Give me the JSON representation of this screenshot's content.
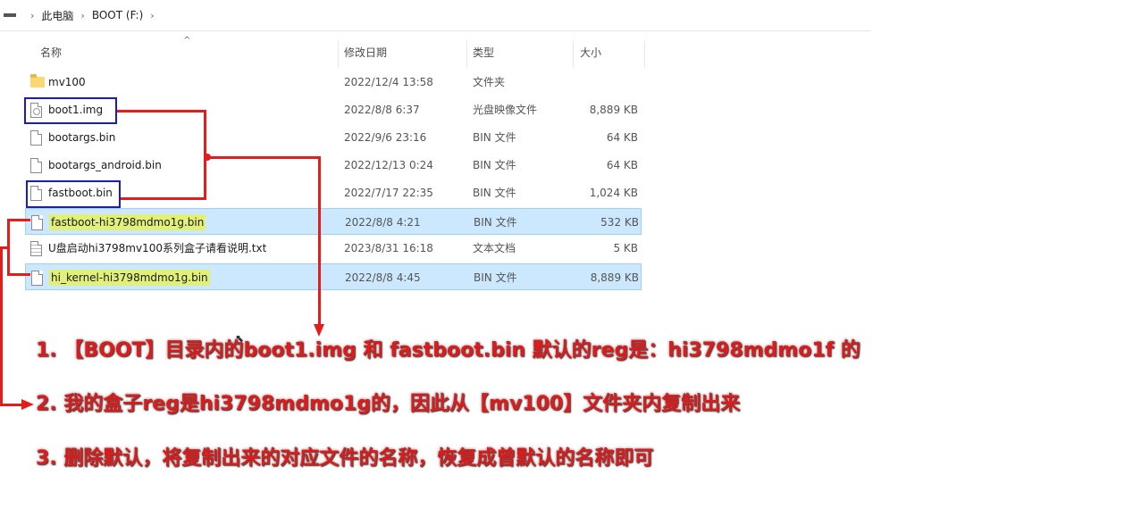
{
  "address_bar": {
    "crumbs": [
      "此电脑",
      "BOOT (F:)"
    ]
  },
  "columns": {
    "name": "名称",
    "date": "修改日期",
    "type": "类型",
    "size": "大小"
  },
  "files": [
    {
      "name": "mv100",
      "date": "2022/12/4 13:58",
      "type": "文件夹",
      "size": "",
      "icon": "folder-icon"
    },
    {
      "name": "boot1.img",
      "date": "2022/8/8 6:37",
      "type": "光盘映像文件",
      "size": "8,889 KB",
      "icon": "disc-image-file-icon"
    },
    {
      "name": "bootargs.bin",
      "date": "2022/9/6 23:16",
      "type": "BIN 文件",
      "size": "64 KB",
      "icon": "file-icon"
    },
    {
      "name": "bootargs_android.bin",
      "date": "2022/12/13 0:24",
      "type": "BIN 文件",
      "size": "64 KB",
      "icon": "file-icon"
    },
    {
      "name": "fastboot.bin",
      "date": "2022/7/17 22:35",
      "type": "BIN 文件",
      "size": "1,024 KB",
      "icon": "file-icon"
    },
    {
      "name": "fastboot-hi3798mdmo1g.bin",
      "date": "2022/8/8 4:21",
      "type": "BIN 文件",
      "size": "532 KB",
      "icon": "file-icon",
      "selected": true
    },
    {
      "name": "U盘启动hi3798mv100系列盒子请看说明.txt",
      "date": "2023/8/31 16:18",
      "type": "文本文档",
      "size": "5 KB",
      "icon": "text-file-icon"
    },
    {
      "name": "hi_kernel-hi3798mdmo1g.bin",
      "date": "2022/8/8 4:45",
      "type": "BIN 文件",
      "size": "8,889 KB",
      "icon": "file-icon",
      "selected": true
    }
  ],
  "notes": [
    "1. 【BOOT】目录内的boot1.img 和 fastboot.bin 默认的reg是：hi3798mdmo1f 的",
    "2. 我的盒子reg是hi3798mdmo1g的，因此从【mv100】文件夹内复制出来",
    "3. 删除默认，将复制出来的对应文件的名称，恢复成曾默认的名称即可"
  ],
  "colors": {
    "annotation_red": "#e31c1c",
    "box_blue": "#1a1acc",
    "highlight_yellow": "#e2f07a",
    "selection": "#cce8ff"
  }
}
